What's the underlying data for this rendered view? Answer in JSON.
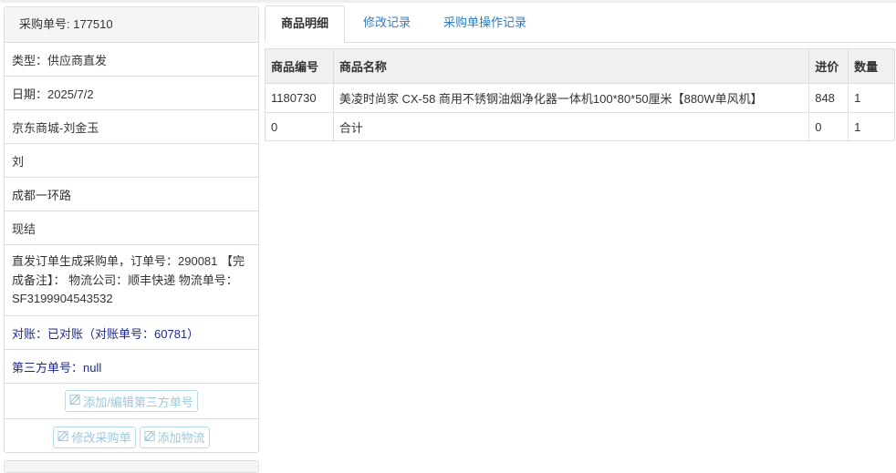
{
  "left": {
    "po_header": "采购单号: 177510",
    "type": "类型：供应商直发",
    "date": "日期：2025/7/2",
    "supplier": "京东商城-刘金玉",
    "contact": "刘",
    "address": "成都一环路",
    "payment": "现结",
    "remark": "直发订单生成采购单，订单号：290081 【完成备注】： 物流公司：顺丰快递 物流单号：SF3199904543532",
    "reconcile": "对账：已对账（对账单号：60781）",
    "third_party": "第三方单号：null",
    "btn_third_party": "添加/编辑第三方单号",
    "btn_edit_po": "修改采购单",
    "btn_add_logistics": "添加物流"
  },
  "tabs": [
    "商品明细",
    "修改记录",
    "采购单操作记录"
  ],
  "table": {
    "headers": [
      "商品编号",
      "商品名称",
      "进价",
      "数量"
    ],
    "rows": [
      [
        "1180730",
        "美凌时尚家 CX-58 商用不锈钢油烟净化器一体机100*80*50厘米【880W单风机】",
        "848",
        "1"
      ],
      [
        "0",
        "合计",
        "0",
        "1"
      ]
    ]
  }
}
